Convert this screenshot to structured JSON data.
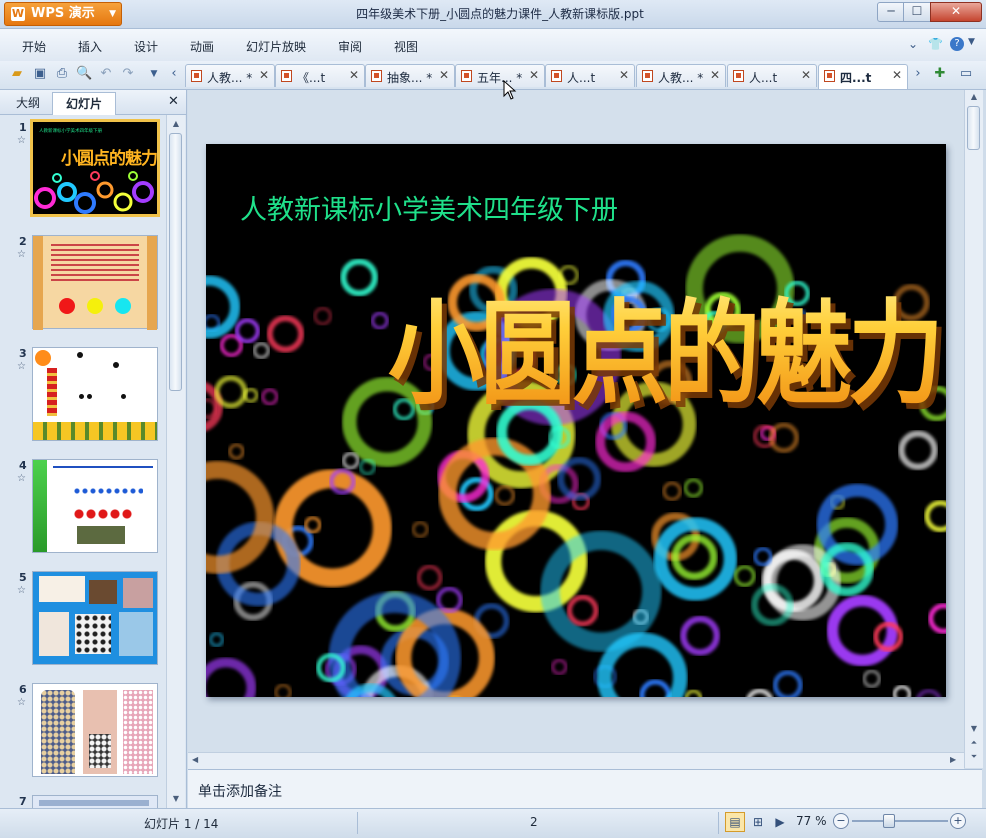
{
  "window": {
    "app_name": "WPS 演示",
    "title": "四年级美术下册_小圆点的魅力课件_人教新课标版.ppt",
    "minimize_label": "─",
    "maximize_label": "☐",
    "close_label": "✕"
  },
  "menu": {
    "items": [
      "开始",
      "插入",
      "设计",
      "动画",
      "幻灯片放映",
      "审阅",
      "视图"
    ]
  },
  "doc_tabs": [
    {
      "label": "人教... *",
      "active": false
    },
    {
      "label": "《...t",
      "active": false
    },
    {
      "label": "抽象... *",
      "active": false
    },
    {
      "label": "五年... *",
      "active": false
    },
    {
      "label": "人...t",
      "active": false
    },
    {
      "label": "人教... *",
      "active": false
    },
    {
      "label": "人...t",
      "active": false
    },
    {
      "label": "四...t",
      "active": true
    }
  ],
  "panel": {
    "tab_outline": "大纲",
    "tab_slides": "幻灯片",
    "close_label": "✕",
    "thumbnails": [
      {
        "number": "1",
        "heading": "人教新课标小学美术四年级下册",
        "title": "小圆点的魅力",
        "selected": true
      },
      {
        "number": "2",
        "selected": false
      },
      {
        "number": "3",
        "selected": false
      },
      {
        "number": "4",
        "selected": false
      },
      {
        "number": "5",
        "selected": false
      },
      {
        "number": "6",
        "selected": false
      },
      {
        "number": "7",
        "selected": false
      }
    ]
  },
  "slide": {
    "subtitle": "人教新课标小学美术四年级下册",
    "title": "小圆点的魅力",
    "ring_colors": [
      "#ff2bd6",
      "#21c9ff",
      "#2f7bff",
      "#ff9a2e",
      "#f4ff3a",
      "#a43cff",
      "#33ffd2",
      "#ff3b5c",
      "#9dff36",
      "#ffffff"
    ]
  },
  "notes": {
    "placeholder": "单击添加备注"
  },
  "status": {
    "slide_info": "幻灯片 1 / 14",
    "page_number": "2",
    "zoom_label": "77 %",
    "zoom_value": 77
  }
}
